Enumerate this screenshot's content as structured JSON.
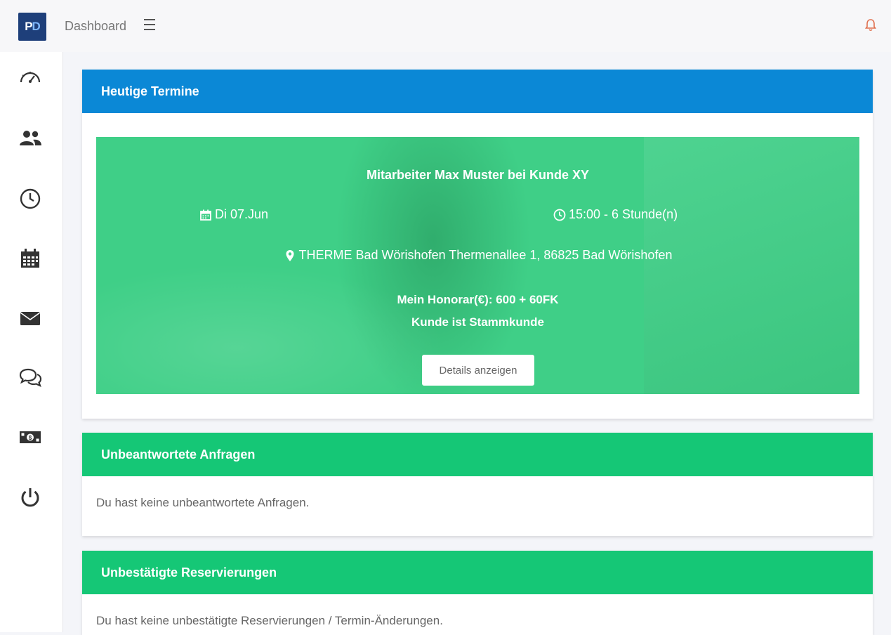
{
  "topbar": {
    "logo_text_a": "P",
    "logo_text_b": "D",
    "breadcrumb": "Dashboard",
    "menu_icon": "hamburger-icon",
    "bell_icon": "bell-icon",
    "bell_color": "#e0704f"
  },
  "sidebar": {
    "items": [
      {
        "icon": "speedometer-icon"
      },
      {
        "icon": "users-icon"
      },
      {
        "icon": "clock-icon"
      },
      {
        "icon": "calendar-icon"
      },
      {
        "icon": "envelope-icon"
      },
      {
        "icon": "chat-icon"
      },
      {
        "icon": "money-icon"
      },
      {
        "icon": "power-icon"
      }
    ]
  },
  "today": {
    "header": "Heutige Termine",
    "header_color": "#0b88d6",
    "appointment": {
      "title": "Mitarbeiter Max Muster bei Kunde XY",
      "date": "Di 07.Jun",
      "time": "15:00 - 6 Stunde(n)",
      "location": "THERME Bad Wörishofen Thermenallee 1, 86825 Bad Wörishofen",
      "fee": "Mein Honorar(€): 600 + 60FK",
      "status": "Kunde ist Stammkunde",
      "button": "Details anzeigen",
      "bg_color": "#3fcf87"
    }
  },
  "requests": {
    "header": "Unbeantwortete Anfragen",
    "empty": "Du hast keine unbeantwortete Anfragen."
  },
  "reservations": {
    "header": "Unbestätigte Reservierungen",
    "empty": "Du hast keine unbestätigte Reservierungen / Termin-Änderungen."
  },
  "accent_green": "#15c776"
}
